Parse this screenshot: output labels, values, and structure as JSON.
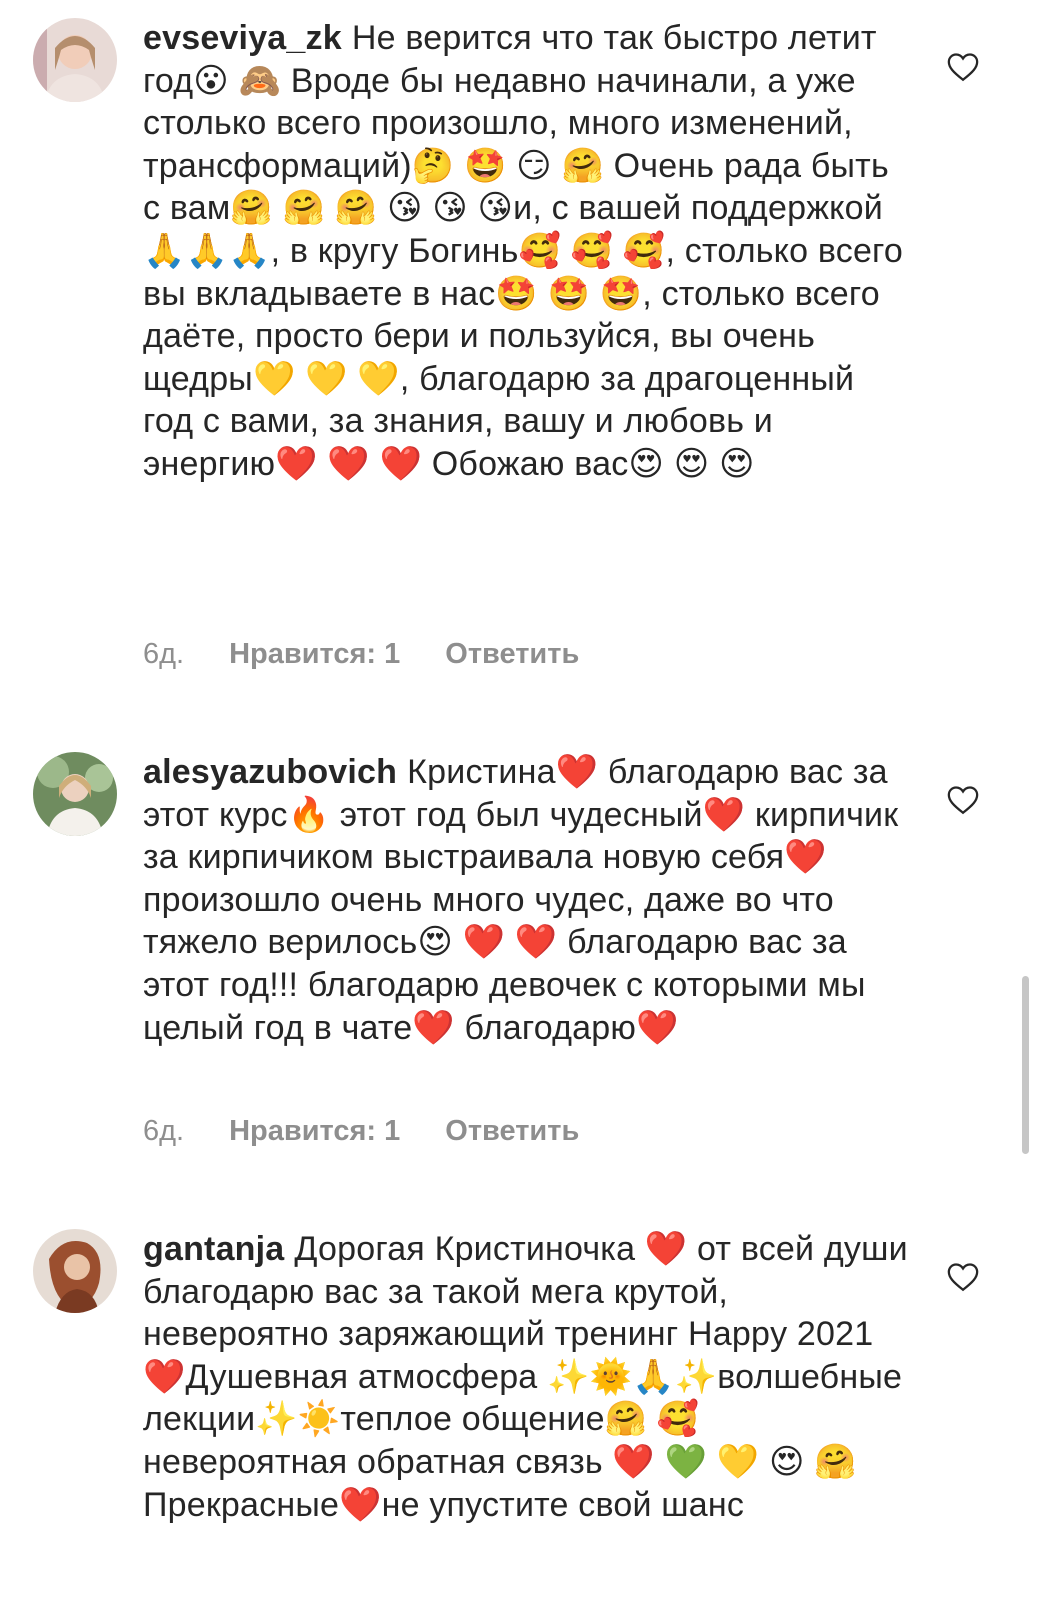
{
  "comments": [
    {
      "username": "evseviya_zk",
      "text": "Не верится что так быстро летит год😮 🙈 Вроде бы недавно начинали, а уже столько всего произошло, много изменений, трансформаций)🤔 🤩 😏 🤗 Очень рада быть с вам🤗 🤗 🤗 😘 😘 😘и, с вашей поддержкой🙏🙏🙏, в кругу Богинь🥰 🥰 🥰, столько всего вы вкладываете в нас🤩 🤩 🤩, столько всего даёте, просто бери и пользуйся, вы очень щедры💛 💛 💛, благодарю за драгоценный год с вами, за знания, вашу и любовь и энергию❤️ ❤️ ❤️ Обожаю вас😍 😍 😍",
      "time": "6д.",
      "likes": "Нравится: 1",
      "reply": "Ответить",
      "avatar_color": "#c9a9a6"
    },
    {
      "username": "alesyazubovich",
      "text": "Кристина❤️ благодарю вас за этот курс🔥 этот год был чудесный❤️ кирпичик за кирпичиком выстраивала новую себя❤️ произошло очень много чудес, даже во что тяжело верилось😍 ❤️ ❤️ благодарю вас за этот год!!! благодарю девочек с которыми мы целый год в чате❤️ благодарю❤️",
      "time": "6д.",
      "likes": "Нравится: 1",
      "reply": "Ответить",
      "avatar_color": "#7d9a6e"
    },
    {
      "username": "gantanja",
      "text": "Дорогая Кристиночка ❤️ от всей души благодарю вас за такой мега крутой, невероятно заряжающий тренинг Happy 2021❤️Душевная атмосфера ✨🌞🙏✨волшебные лекции✨☀️теплое общение🤗 🥰 невероятная обратная связь ❤️ 💚 💛 😍 🤗Прекрасные❤️не упустите свой шанс",
      "avatar_color": "#8a5a44"
    }
  ],
  "icons": {
    "like": "heart-outline-icon"
  }
}
